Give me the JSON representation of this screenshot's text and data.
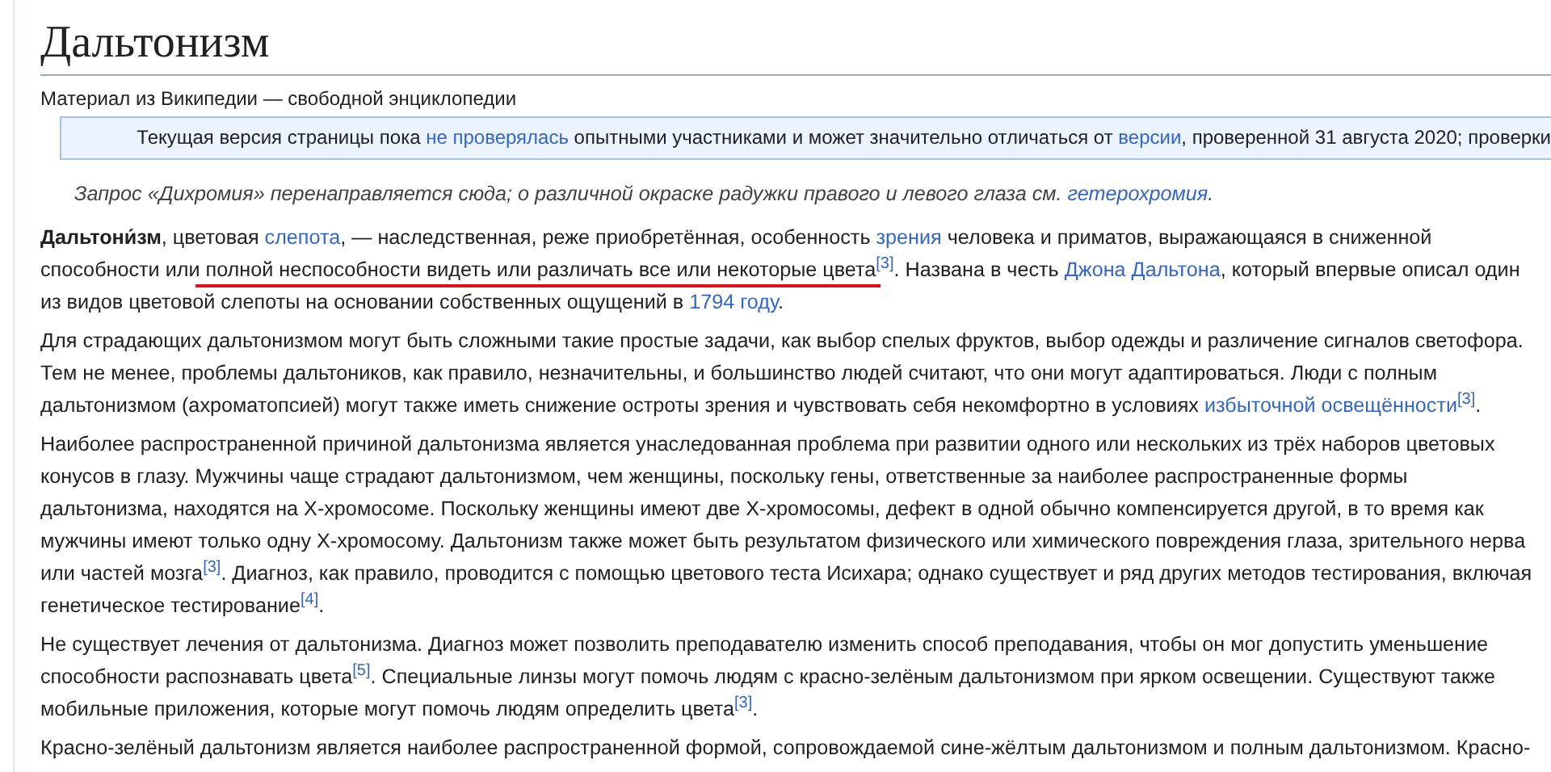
{
  "article": {
    "title": "Дальтонизм",
    "tagline": "Материал из Википедии — свободной энциклопедии",
    "notice": [
      {
        "kind": "text",
        "text": "Текущая версия страницы пока "
      },
      {
        "kind": "link",
        "text": "не проверялась"
      },
      {
        "kind": "text",
        "text": " опытными участниками и может значительно отличаться от "
      },
      {
        "kind": "link",
        "text": "версии"
      },
      {
        "kind": "text",
        "text": ", проверенной 31 августа 2020; проверки"
      }
    ],
    "hatnote": [
      {
        "kind": "text",
        "text": "Запрос «Дихромия» перенаправляется сюда; о различной окраске радужки правого и левого глаза см. "
      },
      {
        "kind": "link",
        "text": "гетерохромия"
      },
      {
        "kind": "text",
        "text": "."
      }
    ],
    "paragraphs": [
      [
        {
          "kind": "text",
          "text": "**Дальтони́зм**, цветовая "
        },
        {
          "kind": "link",
          "text": "слепота"
        },
        {
          "kind": "text",
          "text": ", — наследственная, реже приобретённая, особенность "
        },
        {
          "kind": "link",
          "text": "зрения"
        },
        {
          "kind": "text",
          "text": " человека и приматов, выражающаяся в сниженной способности или "
        },
        {
          "kind": "underlined",
          "text": "полной неспособности видеть или различать все или некоторые цвета"
        },
        {
          "kind": "ref",
          "text": "[3]"
        },
        {
          "kind": "text",
          "text": ". Названа в честь "
        },
        {
          "kind": "link",
          "text": "Джона Дальтона"
        },
        {
          "kind": "text",
          "text": ", который впервые описал один из видов цветовой слепоты на основании собственных ощущений в "
        },
        {
          "kind": "link",
          "text": "1794 году"
        },
        {
          "kind": "text",
          "text": "."
        }
      ],
      [
        {
          "kind": "text",
          "text": "Для страдающих дальтонизмом могут быть сложными такие простые задачи, как выбор спелых фруктов, выбор одежды и различение сигналов светофора. Тем не менее, проблемы дальтоников, как правило, незначительны, и большинство людей считают, что они могут адаптироваться. Люди с полным дальтонизмом (ахроматопсией) могут также иметь снижение остроты зрения и чувствовать себя некомфортно в условиях "
        },
        {
          "kind": "link",
          "text": "избыточной освещённости"
        },
        {
          "kind": "ref",
          "text": "[3]"
        },
        {
          "kind": "text",
          "text": "."
        }
      ],
      [
        {
          "kind": "text",
          "text": "Наиболее распространенной причиной дальтонизма является унаследованная проблема при развитии одного или нескольких из трёх наборов цветовых конусов в глазу. Мужчины чаще страдают дальтонизмом, чем женщины, поскольку гены, ответственные за наиболее распространенные формы дальтонизма, находятся на X-хромосоме. Поскольку женщины имеют две X-хромосомы, дефект в одной обычно компенсируется другой, в то время как мужчины имеют только одну X-хромосому. Дальтонизм также может быть результатом физического или химического повреждения глаза, зрительного нерва или частей мозга"
        },
        {
          "kind": "ref",
          "text": "[3]"
        },
        {
          "kind": "text",
          "text": ". Диагноз, как правило, проводится с помощью цветового теста Исихара; однако существует и ряд других методов тестирования, включая генетическое тестирование"
        },
        {
          "kind": "ref",
          "text": "[4]"
        },
        {
          "kind": "text",
          "text": "."
        }
      ],
      [
        {
          "kind": "text",
          "text": "Не существует лечения от дальтонизма. Диагноз может позволить преподавателю изменить способ преподавания, чтобы он мог допустить уменьшение способности распознавать цвета"
        },
        {
          "kind": "ref",
          "text": "[5]"
        },
        {
          "kind": "text",
          "text": ". Специальные линзы могут помочь людям с красно-зелёным дальтонизмом при ярком освещении. Существуют также мобильные приложения, которые могут помочь людям определить цвета"
        },
        {
          "kind": "ref",
          "text": "[3]"
        },
        {
          "kind": "text",
          "text": "."
        }
      ],
      [
        {
          "kind": "text",
          "text": "Красно-зелёный дальтонизм является наиболее распространенной формой, сопровождаемой сине-жёлтым дальтонизмом и полным дальтонизмом. Красно-"
        }
      ]
    ]
  }
}
